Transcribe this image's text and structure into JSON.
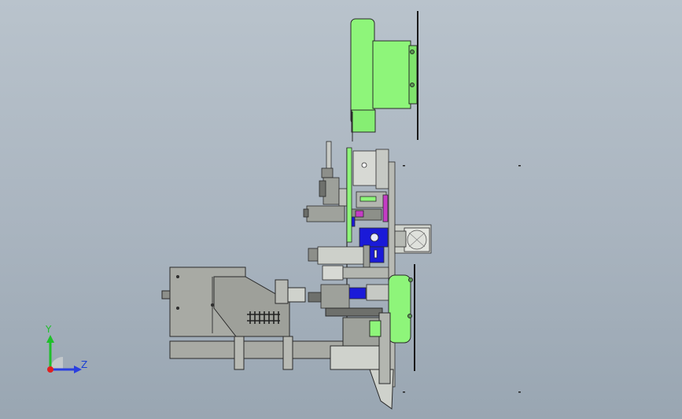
{
  "triad": {
    "y_label": "Y",
    "z_label": "Z",
    "y_color": "#1fbf2a",
    "z_color": "#2a3fe0",
    "x_color": "#e02020"
  },
  "colors": {
    "green_part": "#8ef57a",
    "gray_part": "#a8aaa4",
    "dark_line": "#2a2a2a",
    "blue_part": "#1a1ad8",
    "magenta_part": "#c43cc4",
    "light_panel": "#cfd2cc"
  }
}
